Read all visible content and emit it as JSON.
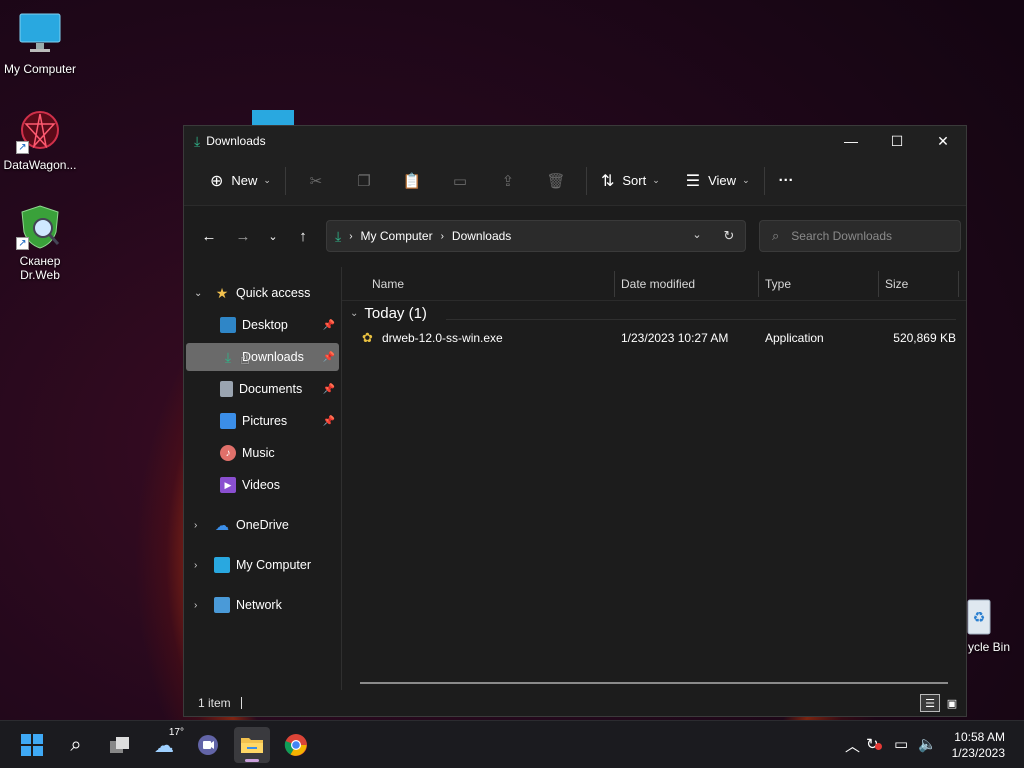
{
  "desktop": {
    "icons": [
      {
        "label": "My Computer"
      },
      {
        "label": "DataWagon..."
      },
      {
        "label": "Сканер Dr.Web"
      },
      {
        "label": "ycle Bin"
      }
    ]
  },
  "window": {
    "title": "Downloads",
    "toolbar": {
      "new_label": "New",
      "sort_label": "Sort",
      "view_label": "View",
      "more_label": "···"
    },
    "address": {
      "crumbs": [
        "My Computer",
        "Downloads"
      ]
    },
    "search": {
      "placeholder": "Search Downloads"
    },
    "sidebar": {
      "quick_access": "Quick access",
      "items": [
        {
          "label": "Desktop",
          "pinned": true
        },
        {
          "label": "Downloads",
          "pinned": true,
          "selected": true
        },
        {
          "label": "Documents",
          "pinned": true
        },
        {
          "label": "Pictures",
          "pinned": true
        },
        {
          "label": "Music",
          "pinned": false
        },
        {
          "label": "Videos",
          "pinned": false
        }
      ],
      "roots": [
        {
          "label": "OneDrive"
        },
        {
          "label": "My Computer"
        },
        {
          "label": "Network"
        }
      ]
    },
    "columns": [
      "Name",
      "Date modified",
      "Type",
      "Size"
    ],
    "group": {
      "label": "Today (1)"
    },
    "files": [
      {
        "name": "drweb-12.0-ss-win.exe",
        "date": "1/23/2023 10:27 AM",
        "type": "Application",
        "size": "520,869 KB"
      }
    ],
    "status": {
      "item_count": "1 item"
    }
  },
  "taskbar": {
    "weather_temp": "17°",
    "clock_time": "10:58 AM",
    "clock_date": "1/23/2023"
  },
  "colors": {
    "accent_download": "#2fb58a",
    "folder_yellow": "#f2c14e",
    "onedrive_blue": "#3b8ee8"
  }
}
